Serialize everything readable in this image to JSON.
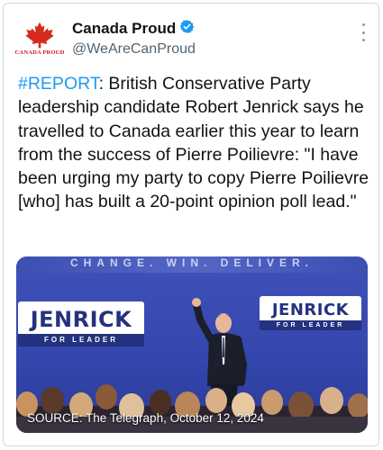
{
  "account": {
    "display_name": "Canada Proud",
    "handle": "@WeAreCanProud",
    "avatar_text": "CANADA PROUD",
    "verified": true,
    "verified_color": "#1d9bf0"
  },
  "tweet": {
    "hashtag": "#REPORT",
    "text": ": British Conservative Party leadership candidate Robert Jenrick says he travelled to Canada earlier this year to learn from the success of Pierre Poilievre: \"I have been urging my party to copy Pierre Poilievre [who] has built a 20-point opinion poll lead.\"",
    "hashtag_color": "#1d9bf0"
  },
  "media": {
    "slogan": "CHANGE. WIN. DELIVER.",
    "panel_left": {
      "name": "JENRICK",
      "sub": "FOR LEADER"
    },
    "panel_right": {
      "name": "JENRICK",
      "sub": "FOR LEADER"
    },
    "caption": "SOURCE: The Telegraph, October 12, 2024"
  },
  "icons": {
    "avatar": "maple-leaf-icon",
    "verified": "verified-badge-icon",
    "more": "more-options-icon"
  }
}
